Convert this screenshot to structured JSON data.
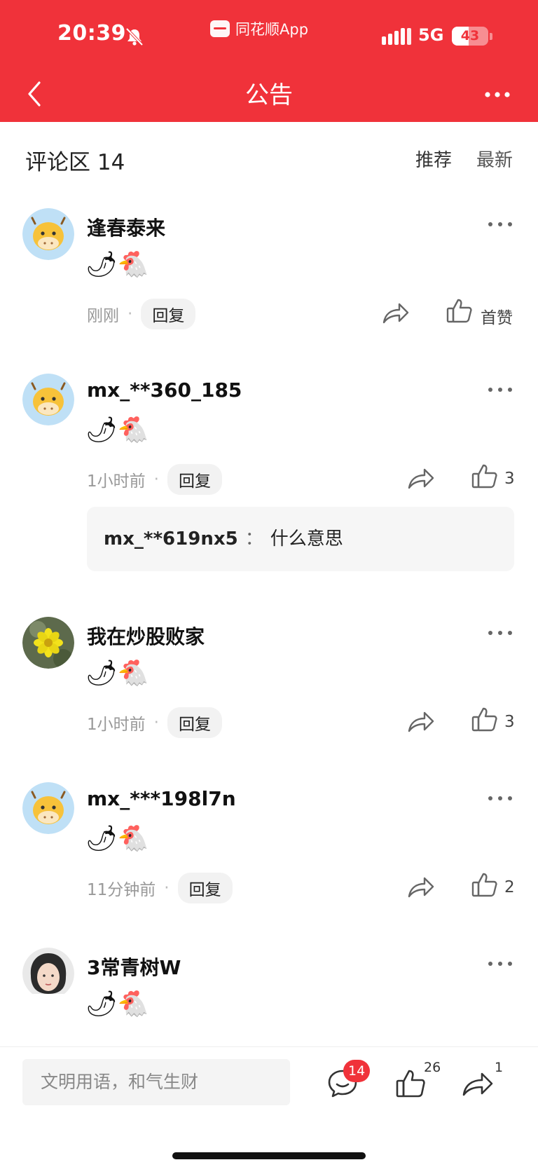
{
  "status_bar": {
    "time": "20:39",
    "app_name": "同花顺App",
    "network": "5G",
    "battery": "43"
  },
  "header": {
    "title": "公告"
  },
  "comments_section": {
    "title": "评论区 14",
    "sort_recommended": "推荐",
    "sort_latest": "最新"
  },
  "comments": [
    {
      "username": "逢春泰来",
      "content": "🌶🐔",
      "time": "刚刚",
      "reply_label": "回复",
      "like_label": "首赞"
    },
    {
      "username": "mx_**360_185",
      "content": "🌶🐔",
      "time": "1小时前",
      "reply_label": "回复",
      "like_label": "3",
      "subreply": {
        "user": "mx_**619nx5",
        "separator": "：",
        "text": "什么意思"
      }
    },
    {
      "username": "我在炒股败家",
      "content": "🌶🐔",
      "time": "1小时前",
      "reply_label": "回复",
      "like_label": "3"
    },
    {
      "username": "mx_***198l7n",
      "content": "🌶🐔",
      "time": "11分钟前",
      "reply_label": "回复",
      "like_label": "2"
    },
    {
      "username": "3常青树W",
      "content": "🌶🐔"
    }
  ],
  "bottom_bar": {
    "input_placeholder": "文明用语，和气生财",
    "comment_badge": "14",
    "like_count": "26",
    "share_count": "1"
  },
  "colors": {
    "brand_red": "#f0323a",
    "chip_bg": "#f2f2f2",
    "subreply_bg": "#f6f6f6"
  },
  "icons": [
    "bell-muted-icon",
    "signal-icon",
    "battery-icon",
    "back-icon",
    "more-icon",
    "share-icon",
    "thumbs-up-icon",
    "comment-icon"
  ]
}
